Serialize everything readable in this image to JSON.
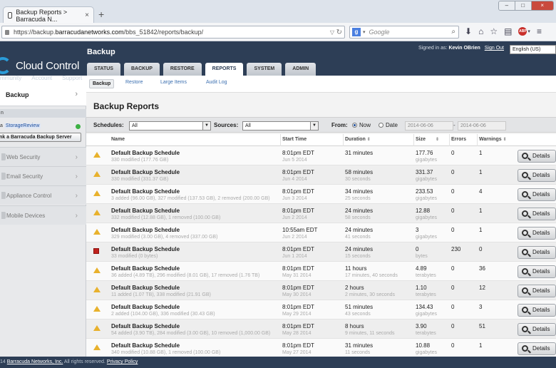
{
  "browser": {
    "tab_title": "Backup Reports > Barracuda N...",
    "url_prefix": "https://backup.",
    "url_host": "barracudanetworks.com",
    "url_path": "/bbs_51842/reports/backup/",
    "search_placeholder": "Google"
  },
  "header": {
    "logo_text": "Cloud Control",
    "sublinks": [
      "mmunity",
      "Account",
      "Support"
    ],
    "page_title": "Backup",
    "signed_in_label": "Signed in as:",
    "user_name": "Kevin OBrien",
    "sign_out": "Sign Out",
    "language": "English (US)",
    "tabs": [
      "STATUS",
      "BACKUP",
      "RESTORE",
      "REPORTS",
      "SYSTEM",
      "ADMIN"
    ],
    "active_tab": "REPORTS"
  },
  "sidebar": {
    "active_item": "Backup",
    "cut_label": "n",
    "device_prefix": "a",
    "device_name": "StorageReview",
    "link_button": "nk a Barracuda Backup Server",
    "items": [
      "Web Security",
      "Email Security",
      "Appliance Control",
      "Mobile Devices"
    ]
  },
  "subnav": {
    "items": [
      "Backup",
      "Restore",
      "Large Items",
      "Audit Log"
    ]
  },
  "content": {
    "title": "Backup Reports",
    "filters": {
      "schedules_label": "Schedules:",
      "schedules_value": "All",
      "sources_label": "Sources:",
      "sources_value": "All",
      "from_label": "From:",
      "now_label": "Now",
      "date_label": "Date",
      "date_from": "2014-06-06",
      "date_to": "2014-06-06",
      "dash": "-"
    },
    "columns": [
      "Name",
      "Start Time",
      "Duration",
      "Size",
      "Errors",
      "Warnings"
    ],
    "details_label": "Details",
    "rows": [
      {
        "status": "warning",
        "name": "Default Backup Schedule",
        "sub": "330 modified (177.76 GB)",
        "time": "8:01pm EDT",
        "date": "Jun 5 2014",
        "duration": "31 minutes",
        "duration_sub": "",
        "size": "177.76",
        "unit": "gigabytes",
        "errors": "0",
        "warnings": "1"
      },
      {
        "status": "warning",
        "name": "Default Backup Schedule",
        "sub": "330 modified (331.37 GB)",
        "time": "8:01pm EDT",
        "date": "Jun 4 2014",
        "duration": "58 minutes",
        "duration_sub": "30 seconds",
        "size": "331.37",
        "unit": "gigabytes",
        "errors": "0",
        "warnings": "1"
      },
      {
        "status": "warning",
        "name": "Default Backup Schedule",
        "sub": "3 added (96.00 GB), 327 modified (137.53 GB), 2 removed (200.00 GB)",
        "time": "8:01pm EDT",
        "date": "Jun 3 2014",
        "duration": "34 minutes",
        "duration_sub": "25 seconds",
        "size": "233.53",
        "unit": "gigabytes",
        "errors": "0",
        "warnings": "4"
      },
      {
        "status": "warning",
        "name": "Default Backup Schedule",
        "sub": "332 modified (12.88 GB), 1 removed (100.00 GB)",
        "time": "8:01pm EDT",
        "date": "Jun 2 2014",
        "duration": "24 minutes",
        "duration_sub": "58 seconds",
        "size": "12.88",
        "unit": "gigabytes",
        "errors": "0",
        "warnings": "1"
      },
      {
        "status": "warning",
        "name": "Default Backup Schedule",
        "sub": "329 modified (3.00 GB), 4 removed (337.00 GB)",
        "time": "10:55am EDT",
        "date": "Jun 2 2014",
        "duration": "24 minutes",
        "duration_sub": "41 seconds",
        "size": "3",
        "unit": "gigabytes",
        "errors": "0",
        "warnings": "1"
      },
      {
        "status": "error",
        "name": "Default Backup Schedule",
        "sub": "33 modified (0 bytes)",
        "time": "8:01pm EDT",
        "date": "Jun 1 2014",
        "duration": "24 minutes",
        "duration_sub": "15 seconds",
        "size": "0",
        "unit": "bytes",
        "errors": "230",
        "warnings": "0"
      },
      {
        "status": "warning",
        "name": "Default Backup Schedule",
        "sub": "36 added (4.89 TB), 296 modified (8.01 GB), 17 removed (1.76 TB)",
        "time": "8:01pm EDT",
        "date": "May 31 2014",
        "duration": "11 hours",
        "duration_sub": "17 minutes, 40 seconds",
        "size": "4.89",
        "unit": "terabytes",
        "errors": "0",
        "warnings": "36"
      },
      {
        "status": "warning",
        "name": "Default Backup Schedule",
        "sub": "11 added (1.07 TB), 338 modified (21.91 GB)",
        "time": "8:01pm EDT",
        "date": "May 30 2014",
        "duration": "2 hours",
        "duration_sub": "2 minutes, 30 seconds",
        "size": "1.10",
        "unit": "terabytes",
        "errors": "0",
        "warnings": "12"
      },
      {
        "status": "warning",
        "name": "Default Backup Schedule",
        "sub": "2 added (104.00 GB), 336 modified (30.43 GB)",
        "time": "8:01pm EDT",
        "date": "May 29 2014",
        "duration": "51 minutes",
        "duration_sub": "43 seconds",
        "size": "134.43",
        "unit": "gigabytes",
        "errors": "0",
        "warnings": "3"
      },
      {
        "status": "warning",
        "name": "Default Backup Schedule",
        "sub": "54 added (3.90 TB), 284 modified (3.00 GB), 10 removed (1,000.00 GB)",
        "time": "8:01pm EDT",
        "date": "May 28 2014",
        "duration": "8 hours",
        "duration_sub": "9 minutes, 11 seconds",
        "size": "3.90",
        "unit": "terabytes",
        "errors": "0",
        "warnings": "51"
      },
      {
        "status": "warning",
        "name": "Default Backup Schedule",
        "sub": "340 modified (10.88 GB), 1 removed (100.00 GB)",
        "time": "8:01pm EDT",
        "date": "May 27 2014",
        "duration": "31 minutes",
        "duration_sub": "11 seconds",
        "size": "10.88",
        "unit": "gigabytes",
        "errors": "0",
        "warnings": "1"
      }
    ]
  },
  "footer": {
    "year": "14",
    "company": "Barracuda Networks, Inc.",
    "rights": "All rights reserved.",
    "privacy": "Privacy Policy"
  }
}
